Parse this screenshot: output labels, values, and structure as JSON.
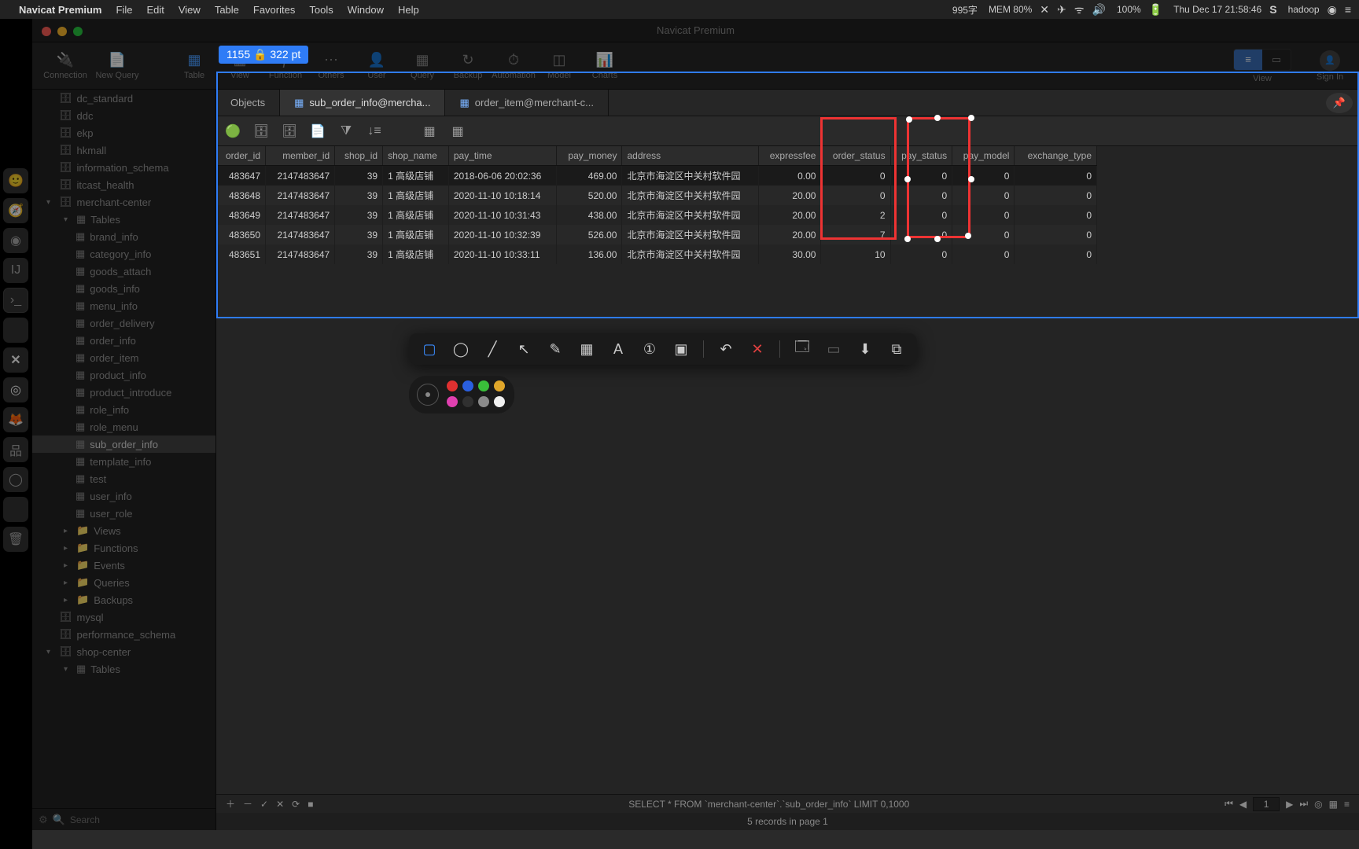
{
  "menubar": {
    "apple": "",
    "app": "Navicat Premium",
    "items": [
      "File",
      "Edit",
      "View",
      "Table",
      "Favorites",
      "Tools",
      "Window",
      "Help"
    ],
    "right": {
      "ime": "995字",
      "mem": "MEM 80%",
      "battery": "100%",
      "clock": "Thu Dec 17  21:58:46",
      "user": "hadoop"
    }
  },
  "window": {
    "title": "Navicat Premium"
  },
  "toolbar": {
    "buttons": [
      "Connection",
      "New Query",
      "Table",
      "View",
      "Function",
      "Others",
      "User",
      "Query",
      "Backup",
      "Automation",
      "Model",
      "Charts"
    ],
    "view_label": "View",
    "signin": "Sign In"
  },
  "sidebar": {
    "databases_top": [
      "dc_standard",
      "ddc",
      "ekp",
      "hkmall",
      "information_schema",
      "itcast_health"
    ],
    "merchant_center": "merchant-center",
    "tables_label": "Tables",
    "tables": [
      "brand_info",
      "category_info",
      "goods_attach",
      "goods_info",
      "menu_info",
      "order_delivery",
      "order_info",
      "order_item",
      "product_info",
      "product_introduce",
      "role_info",
      "role_menu",
      "sub_order_info",
      "template_info",
      "test",
      "user_info",
      "user_role"
    ],
    "folders": [
      "Views",
      "Functions",
      "Events",
      "Queries",
      "Backups"
    ],
    "databases_bottom": [
      "mysql",
      "performance_schema"
    ],
    "shop_center": "shop-center",
    "shop_tables": "Tables",
    "search_placeholder": "Search"
  },
  "tabs": {
    "t0": "Objects",
    "t1": "sub_order_info@mercha...",
    "t2": "order_item@merchant-c..."
  },
  "columns": [
    "order_id",
    "member_id",
    "shop_id",
    "shop_name",
    "pay_time",
    "pay_money",
    "address",
    "expressfee",
    "order_status",
    "pay_status",
    "pay_model",
    "exchange_type"
  ],
  "rows": [
    {
      "order_id": "483647",
      "member_id": "2147483647",
      "shop_id": "39",
      "shop_name": "1  高级店铺",
      "pay_time": "2018-06-06 20:02:36",
      "pay_money": "469.00",
      "address": "北京市海淀区中关村软件园",
      "expressfee": "0.00",
      "order_status": "0",
      "pay_status": "0",
      "pay_model": "0",
      "exchange_type": "0"
    },
    {
      "order_id": "483648",
      "member_id": "2147483647",
      "shop_id": "39",
      "shop_name": "1  高级店铺",
      "pay_time": "2020-11-10 10:18:14",
      "pay_money": "520.00",
      "address": "北京市海淀区中关村软件园",
      "expressfee": "20.00",
      "order_status": "0",
      "pay_status": "0",
      "pay_model": "0",
      "exchange_type": "0"
    },
    {
      "order_id": "483649",
      "member_id": "2147483647",
      "shop_id": "39",
      "shop_name": "1  高级店铺",
      "pay_time": "2020-11-10 10:31:43",
      "pay_money": "438.00",
      "address": "北京市海淀区中关村软件园",
      "expressfee": "20.00",
      "order_status": "2",
      "pay_status": "0",
      "pay_model": "0",
      "exchange_type": "0"
    },
    {
      "order_id": "483650",
      "member_id": "2147483647",
      "shop_id": "39",
      "shop_name": "1  高级店铺",
      "pay_time": "2020-11-10 10:32:39",
      "pay_money": "526.00",
      "address": "北京市海淀区中关村软件园",
      "expressfee": "20.00",
      "order_status": "7",
      "pay_status": "0",
      "pay_model": "0",
      "exchange_type": "0"
    },
    {
      "order_id": "483651",
      "member_id": "2147483647",
      "shop_id": "39",
      "shop_name": "1  高级店铺",
      "pay_time": "2020-11-10 10:33:11",
      "pay_money": "136.00",
      "address": "北京市海淀区中关村软件园",
      "expressfee": "30.00",
      "order_status": "10",
      "pay_status": "0",
      "pay_model": "0",
      "exchange_type": "0"
    }
  ],
  "status": {
    "sql": "SELECT * FROM `merchant-center`.`sub_order_info` LIMIT 0,1000",
    "page": "1",
    "records": "5 records in page 1"
  },
  "screenshot": {
    "size": "1155 🔒 322  pt"
  },
  "annot": {
    "tools": [
      "rect",
      "circle",
      "line",
      "arrow",
      "pencil",
      "grid",
      "text",
      "number",
      "mask",
      "undo",
      "delete",
      "window",
      "screen",
      "download",
      "copy"
    ]
  },
  "colors": {
    "swatches": [
      "#e03030",
      "#2a5fe0",
      "#3abf3a",
      "#e0a62a",
      "#e040b0",
      "#303030",
      "#8a8a8a",
      "#f0f0f0"
    ]
  }
}
